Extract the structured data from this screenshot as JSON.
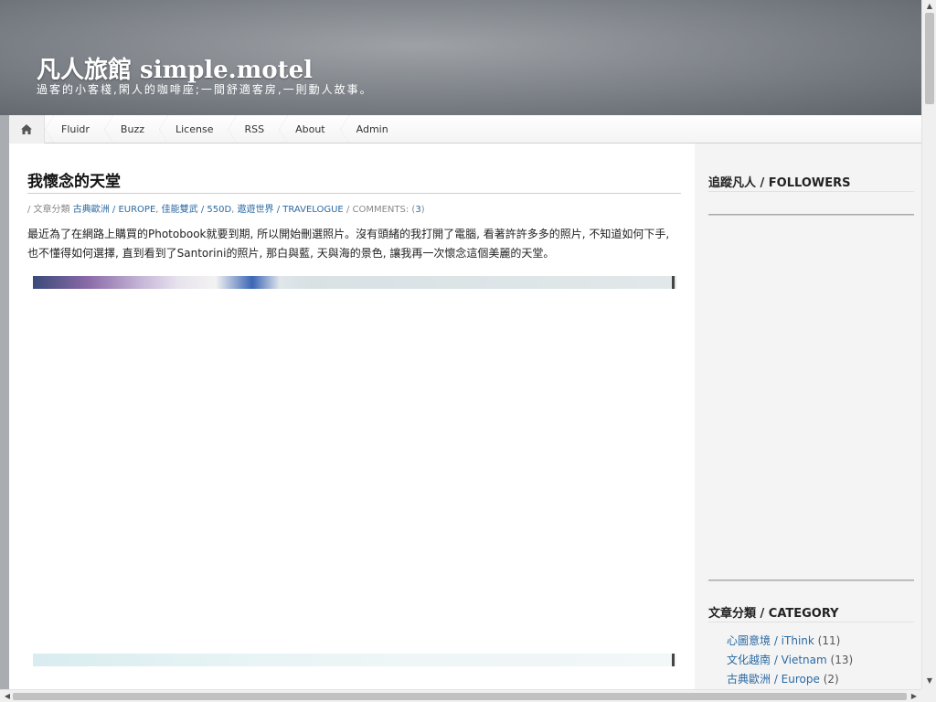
{
  "site": {
    "title": "凡人旅館 simple.motel",
    "description": "過客的小客棧,閑人的咖啡座;一間舒適客房,一則動人故事。"
  },
  "nav": {
    "home_icon": "home-icon",
    "items": [
      {
        "label": "Fluidr"
      },
      {
        "label": "Buzz"
      },
      {
        "label": "License"
      },
      {
        "label": "RSS"
      },
      {
        "label": "About"
      },
      {
        "label": "Admin"
      }
    ]
  },
  "post": {
    "title": "我懷念的天堂",
    "meta": {
      "prefix": "/ 文章分類",
      "categories": [
        {
          "label": "古典歐洲 / EUROPE"
        },
        {
          "label": "佳能雙武 / 550D"
        },
        {
          "label": "遨遊世界 / TRAVELOGUE"
        }
      ],
      "comments_label": "/ COMMENTS: (",
      "comments_count": "3",
      "comments_suffix": ")"
    },
    "body": "最近為了在網路上購買的Photobook就要到期, 所以開始刪選照片。沒有頭緒的我打開了電腦, 看著許許多多的照片, 不知道如何下手, 也不懂得如何選擇, 直到看到了Santorini的照片, 那白與藍, 天與海的景色, 讓我再一次懷念這個美麗的天堂。"
  },
  "sidebar": {
    "followers_title": "追蹤凡人 / FOLLOWERS",
    "category_title": "文章分類 / CATEGORY",
    "categories": [
      {
        "label": "心圖意境 / iThink",
        "count": "(11)"
      },
      {
        "label": "文化越南 / Vietnam",
        "count": "(13)"
      },
      {
        "label": "古典歐洲 / Europe",
        "count": "(2)"
      }
    ]
  },
  "scrollbar": {
    "up_icon": "arrow-up-icon",
    "down_icon": "arrow-down-icon",
    "left_icon": "arrow-left-icon",
    "right_icon": "arrow-right-icon"
  }
}
